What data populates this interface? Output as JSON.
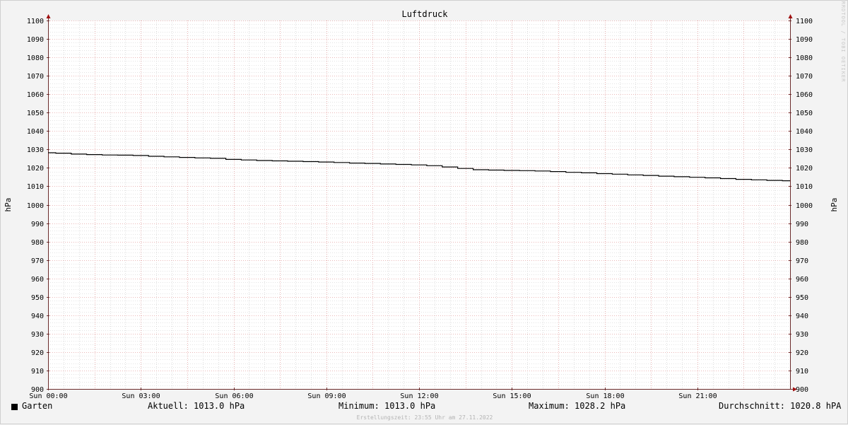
{
  "chart_data": {
    "type": "line",
    "title": "Luftdruck",
    "ylabel": "hPa",
    "ylabel_right": "hPa",
    "ylim": [
      900,
      1100
    ],
    "y_ticks": [
      "900",
      "910",
      "920",
      "930",
      "940",
      "950",
      "960",
      "970",
      "980",
      "990",
      "1000",
      "1010",
      "1020",
      "1030",
      "1040",
      "1050",
      "1060",
      "1070",
      "1080",
      "1090",
      "1100"
    ],
    "x_ticks": [
      "Sun 00:00",
      "Sun 03:00",
      "Sun 06:00",
      "Sun 09:00",
      "Sun 12:00",
      "Sun 15:00",
      "Sun 18:00",
      "Sun 21:00"
    ],
    "grid": true,
    "legend_placement": "bottom-left",
    "series": [
      {
        "name": "Garten",
        "color": "#000000",
        "x_hours": [
          0,
          0.5,
          1,
          1.5,
          2,
          2.5,
          3,
          3.5,
          4,
          4.5,
          5,
          5.5,
          6,
          6.5,
          7,
          7.5,
          8,
          8.5,
          9,
          9.5,
          10,
          10.5,
          11,
          11.5,
          12,
          12.5,
          13,
          13.5,
          14,
          14.5,
          15,
          15.5,
          16,
          16.5,
          17,
          17.5,
          18,
          18.5,
          19,
          19.5,
          20,
          20.5,
          21,
          21.5,
          22,
          22.5,
          23,
          23.5,
          24
        ],
        "values": [
          1028.2,
          1028.0,
          1027.5,
          1027.2,
          1027.0,
          1026.9,
          1026.7,
          1026.3,
          1026.0,
          1025.7,
          1025.4,
          1025.2,
          1024.6,
          1024.3,
          1024.0,
          1023.8,
          1023.6,
          1023.4,
          1023.2,
          1022.9,
          1022.6,
          1022.4,
          1022.1,
          1021.9,
          1021.6,
          1021.2,
          1020.5,
          1019.7,
          1019.0,
          1018.8,
          1018.6,
          1018.5,
          1018.3,
          1018.0,
          1017.6,
          1017.3,
          1016.9,
          1016.6,
          1016.2,
          1015.9,
          1015.5,
          1015.2,
          1014.9,
          1014.6,
          1014.2,
          1013.8,
          1013.5,
          1013.2,
          1013.0
        ]
      }
    ]
  },
  "legend": {
    "series_label": "Garten",
    "aktuell": "Aktuell: 1013.0 hPa",
    "minimum": "Minimum: 1013.0 hPa",
    "maximum": "Maximum: 1028.2 hPa",
    "durchschnitt": "Durchschnitt: 1020.8 hPA"
  },
  "footer": "Erstellungszeit: 23:55 Uhr am 27.11.2022",
  "watermark": "RRDTOOL / TOBI OETIKER",
  "colors": {
    "background": "#f3f3f3",
    "canvas": "#ffffff",
    "minor_grid": "#c8c8c8",
    "major_grid": "#e3a0a0",
    "axis": "#6a2a2a",
    "line": "#000000"
  }
}
